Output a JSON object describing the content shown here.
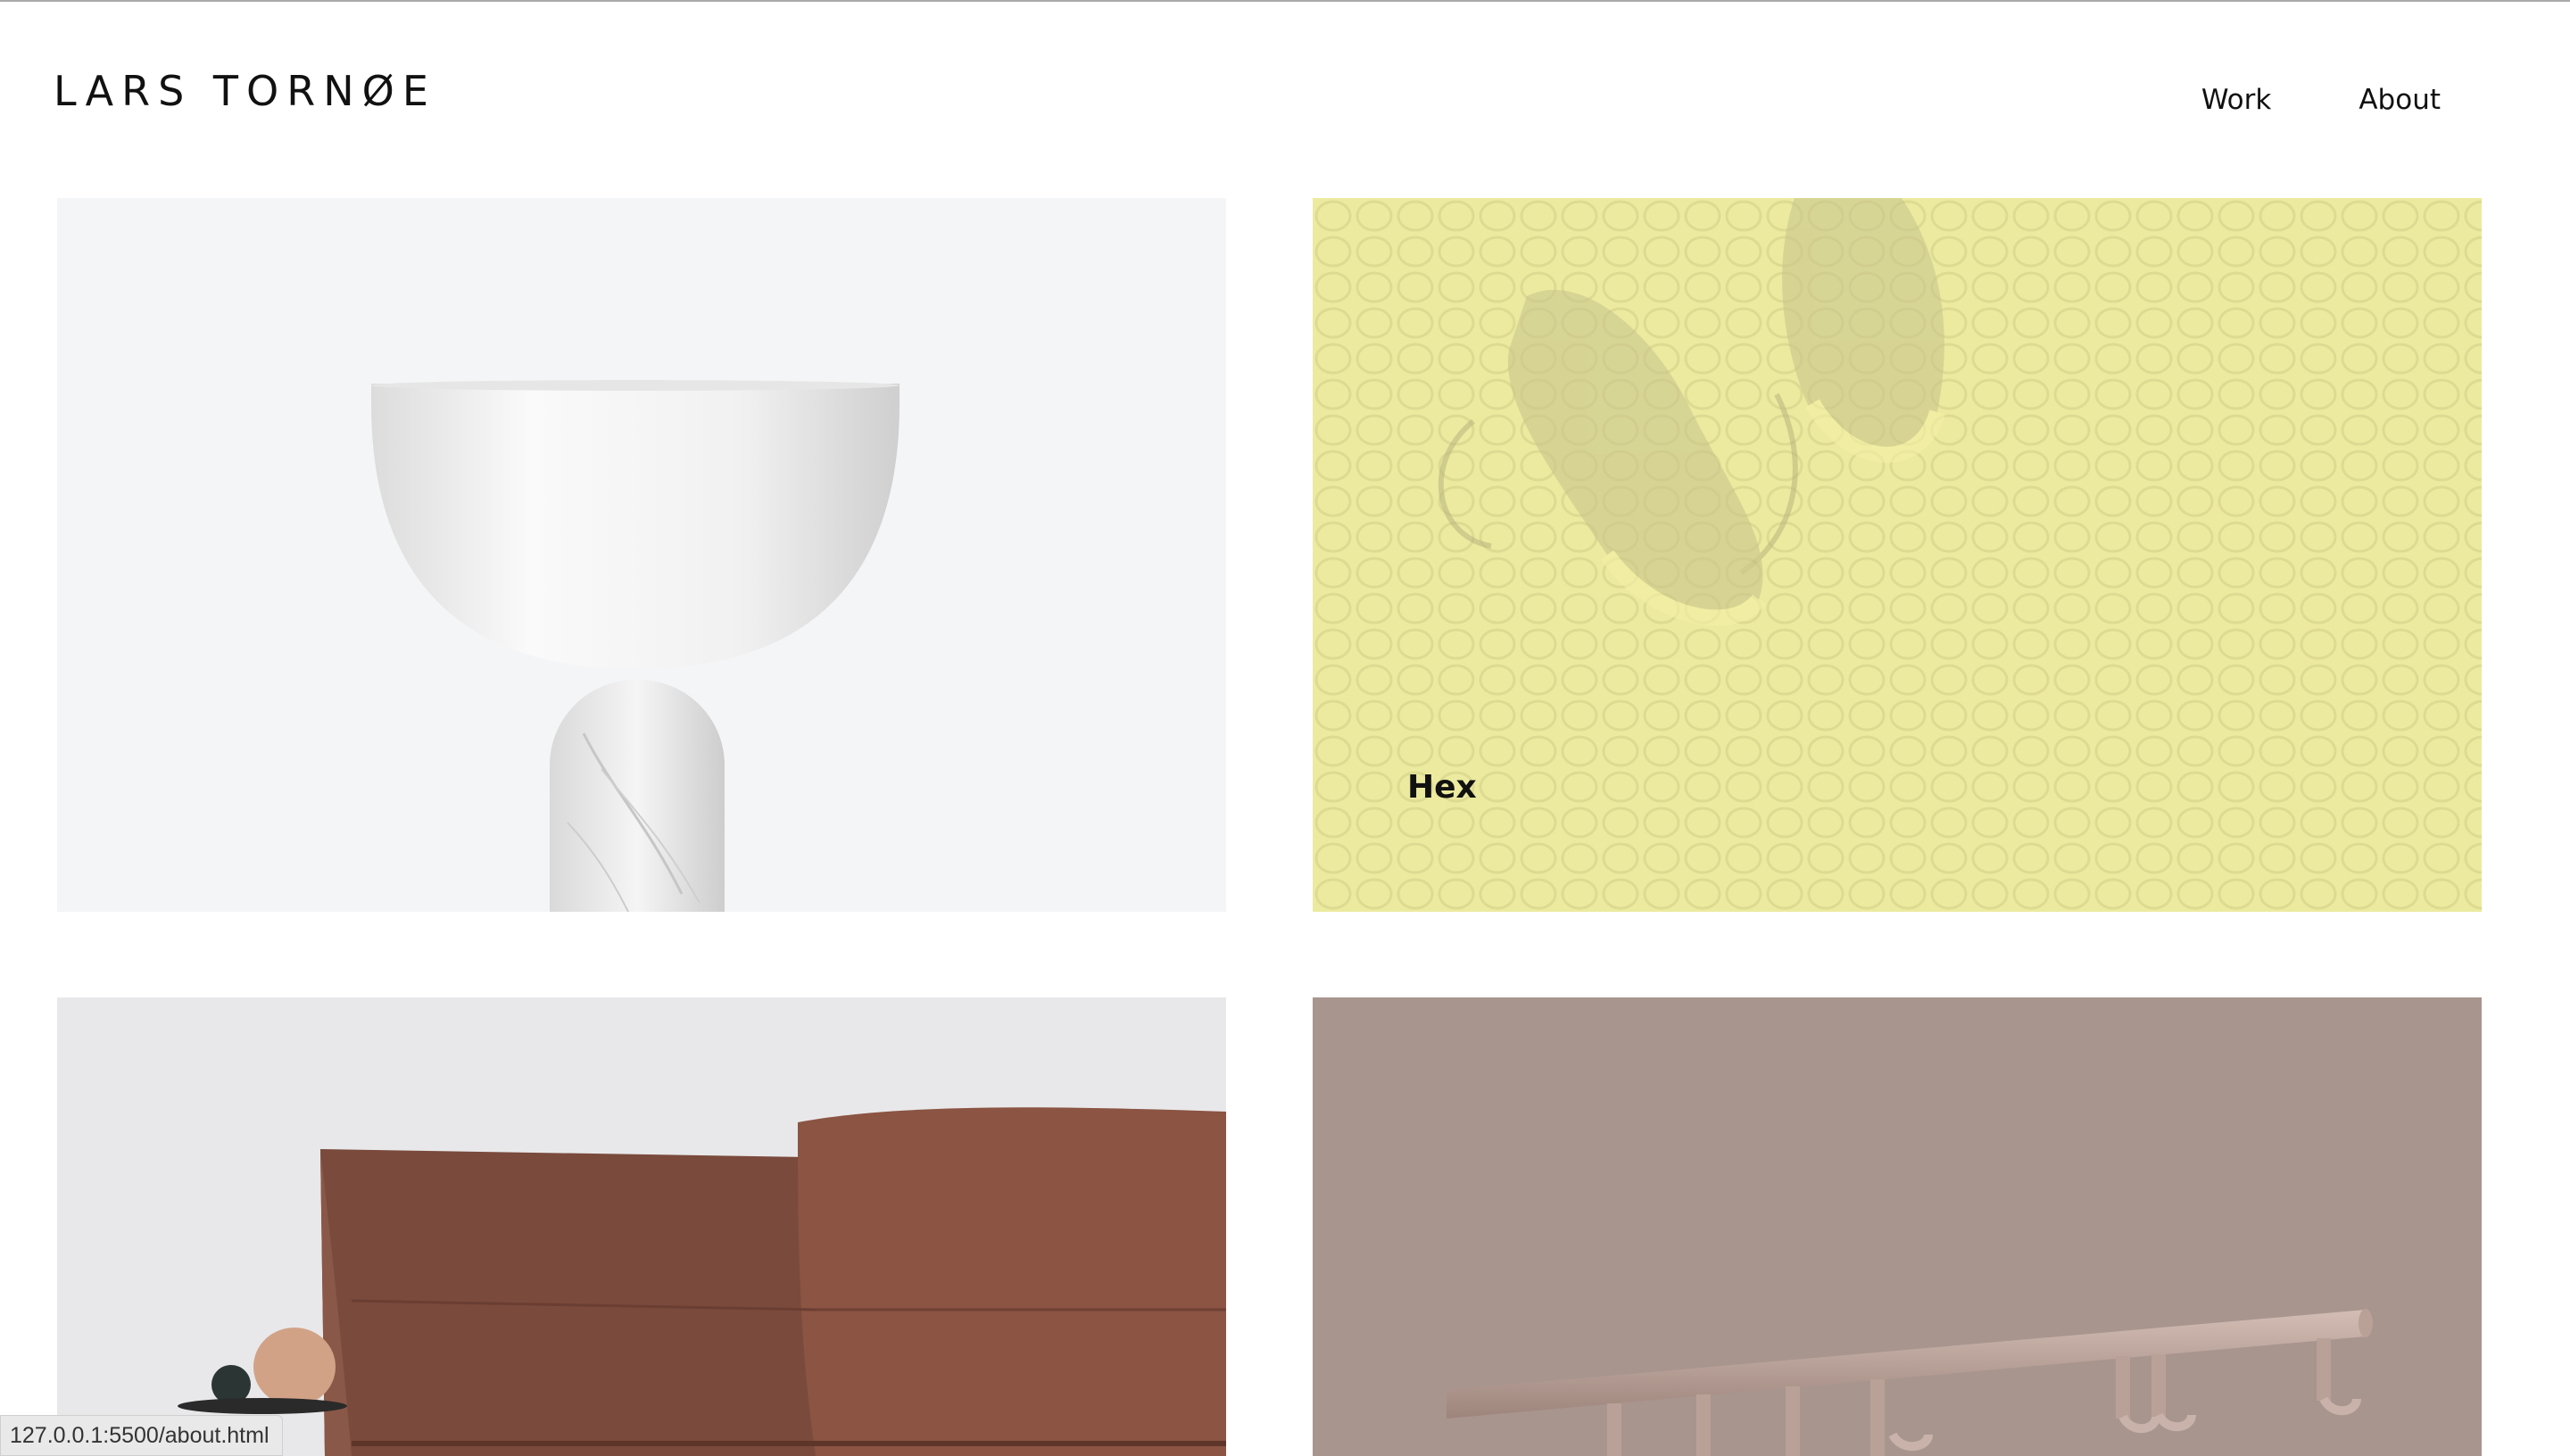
{
  "header": {
    "logo_text": "LARS TORNØE",
    "nav": [
      {
        "label": "Work"
      },
      {
        "label": "About"
      }
    ]
  },
  "projects": [
    {
      "image": "white bowl lamp on marble base",
      "title": ""
    },
    {
      "image": "sneakers on yellow textured surface",
      "title": "Hex"
    },
    {
      "image": "brown leather sofa with side table",
      "title": ""
    },
    {
      "image": "coat rack with hooks on mauve wall",
      "title": ""
    }
  ],
  "status_bar": {
    "url": "127.0.0.1:5500/about.html"
  },
  "colors": {
    "tile_yellow": "#ecea9f",
    "tile_mauve": "#a8958e",
    "tile_light": "#f4f5f7"
  }
}
